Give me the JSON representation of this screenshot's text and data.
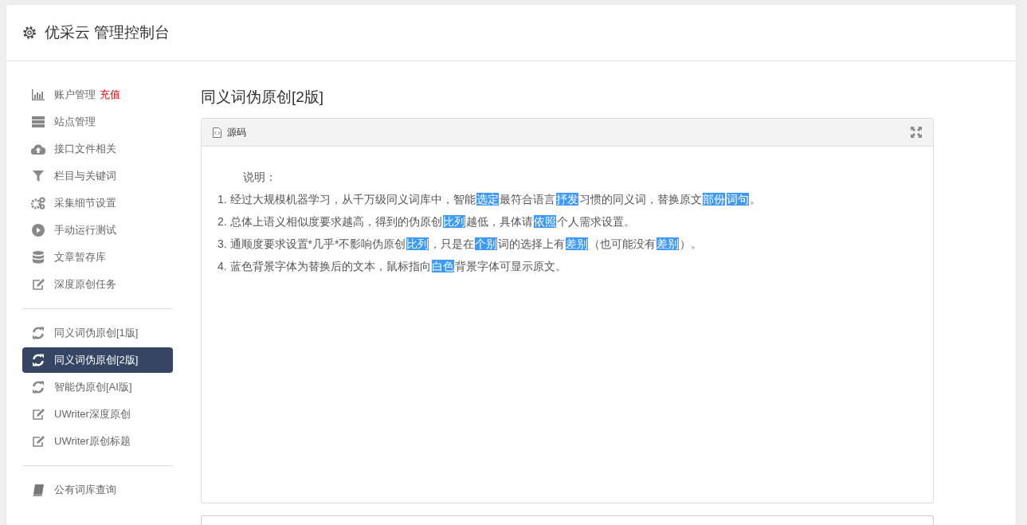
{
  "header": {
    "title": "优采云 管理控制台"
  },
  "sidebar": {
    "groups": [
      {
        "items": [
          {
            "label": "账户管理",
            "badge": "充值",
            "selected": false
          },
          {
            "label": "站点管理",
            "selected": false
          },
          {
            "label": "接口文件相关",
            "selected": false
          },
          {
            "label": "栏目与关键词",
            "selected": false
          },
          {
            "label": "采集细节设置",
            "selected": false
          },
          {
            "label": "手动运行测试",
            "selected": false
          },
          {
            "label": "文章暂存库",
            "selected": false
          },
          {
            "label": "深度原创任务",
            "selected": false
          }
        ]
      },
      {
        "items": [
          {
            "label": "同义词伪原创[1版]",
            "selected": false
          },
          {
            "label": "同义词伪原创[2版]",
            "selected": true
          },
          {
            "label": "智能伪原创[AI版]",
            "selected": false
          },
          {
            "label": "UWriter深度原创",
            "selected": false
          },
          {
            "label": "UWriter原创标题",
            "selected": false
          }
        ]
      },
      {
        "items": [
          {
            "label": "公有词库查询",
            "selected": false
          }
        ]
      }
    ]
  },
  "main": {
    "title": "同义词伪原创[2版]",
    "editor": {
      "toolbar_label": "源码",
      "heading": "说明：",
      "lines": [
        [
          {
            "text": "1. 经过大规模机器学习，从千万级同义词库中，智能",
            "replaced": false
          },
          {
            "text": "选定",
            "replaced": true
          },
          {
            "text": "最符合语言",
            "replaced": false
          },
          {
            "text": "抒发",
            "replaced": true
          },
          {
            "text": "习惯的同义词，替换原文",
            "replaced": false
          },
          {
            "text": "部份",
            "replaced": true
          },
          {
            "text": "词句",
            "replaced": true
          },
          {
            "text": "。",
            "replaced": false
          }
        ],
        [
          {
            "text": "2. 总体上语义相似度要求越高，得到的伪原创",
            "replaced": false
          },
          {
            "text": "比列",
            "replaced": true
          },
          {
            "text": "越低，具体请",
            "replaced": false
          },
          {
            "text": "依照",
            "replaced": true
          },
          {
            "text": "个人需求设置。",
            "replaced": false
          }
        ],
        [
          {
            "text": "3. 通顺度要求设置*几乎*不影响伪原创",
            "replaced": false
          },
          {
            "text": "比列",
            "replaced": true
          },
          {
            "text": "，只是在",
            "replaced": false
          },
          {
            "text": "个别",
            "replaced": true
          },
          {
            "text": "词的选择上有",
            "replaced": false
          },
          {
            "text": "差别",
            "replaced": true
          },
          {
            "text": "（也可能没有",
            "replaced": false
          },
          {
            "text": "差别",
            "replaced": true
          },
          {
            "text": "）。",
            "replaced": false
          }
        ],
        [
          {
            "text": "4. 蓝色背景字体为替换后的文本，鼠标指向",
            "replaced": false
          },
          {
            "text": "白色",
            "replaced": true
          },
          {
            "text": "背景字体可显示原文。",
            "replaced": false
          }
        ]
      ]
    }
  }
}
